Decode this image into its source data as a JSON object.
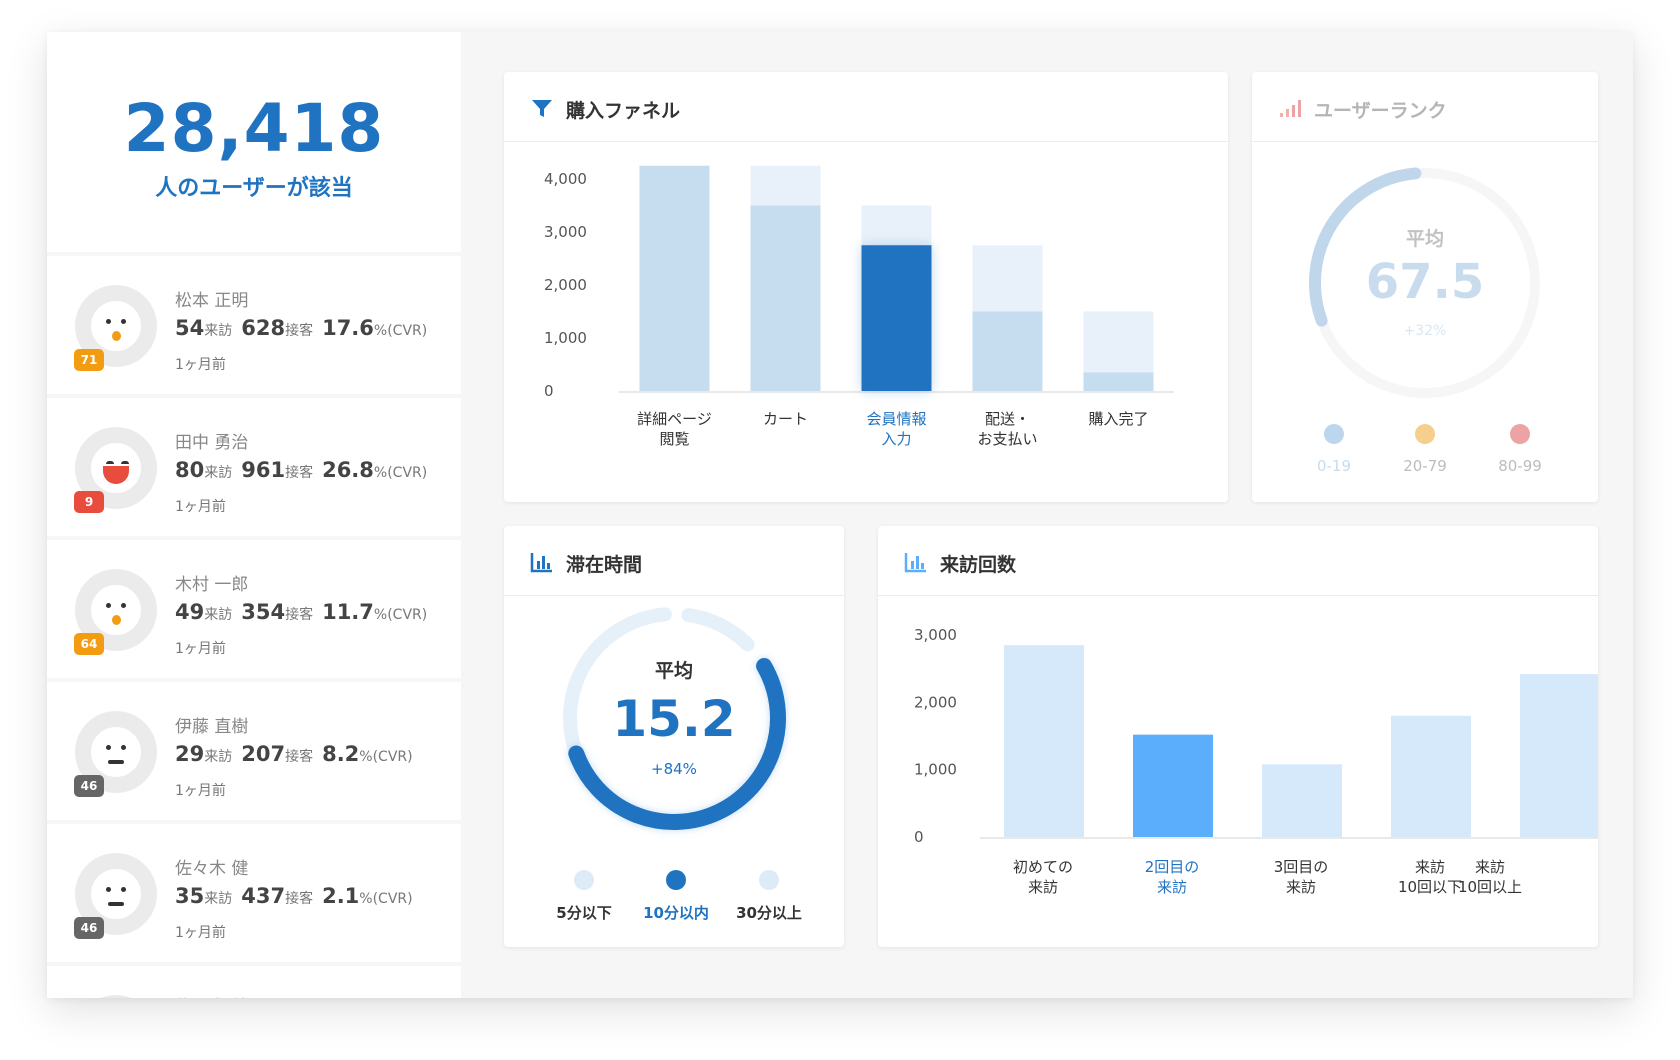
{
  "summary": {
    "count": "28,418",
    "caption": "人のユーザーが該当"
  },
  "users": [
    {
      "name": "松本 正明",
      "visits": "54",
      "visits_unit": "来訪",
      "service": "628",
      "service_unit": "接客",
      "cvr": "17.6",
      "cvr_unit": "%(CVR)",
      "time": "1ヶ月前",
      "rank": "71",
      "rank_color": "#f39c12",
      "face": "o"
    },
    {
      "name": "田中 勇治",
      "visits": "80",
      "visits_unit": "来訪",
      "service": "961",
      "service_unit": "接客",
      "cvr": "26.8",
      "cvr_unit": "%(CVR)",
      "time": "1ヶ月前",
      "rank": "9",
      "rank_color": "#e84c3d",
      "face": "smile"
    },
    {
      "name": "木村 一郎",
      "visits": "49",
      "visits_unit": "来訪",
      "service": "354",
      "service_unit": "接客",
      "cvr": "11.7",
      "cvr_unit": "%(CVR)",
      "time": "1ヶ月前",
      "rank": "64",
      "rank_color": "#f39c12",
      "face": "o"
    },
    {
      "name": "伊藤 直樹",
      "visits": "29",
      "visits_unit": "来訪",
      "service": "207",
      "service_unit": "接客",
      "cvr": "8.2",
      "cvr_unit": "%(CVR)",
      "time": "1ヶ月前",
      "rank": "46",
      "rank_color": "#666666",
      "face": "flat"
    },
    {
      "name": "佐々木 健",
      "visits": "35",
      "visits_unit": "来訪",
      "service": "437",
      "service_unit": "接客",
      "cvr": "2.1",
      "cvr_unit": "%(CVR)",
      "time": "1ヶ月前",
      "rank": "46",
      "rank_color": "#666666",
      "face": "flat"
    }
  ],
  "partial_user": {
    "name": "佐々木 健"
  },
  "funnel": {
    "title": "購入ファネル",
    "icon": "funnel-icon"
  },
  "rank_panel": {
    "title": "ユーザーランク",
    "icon": "signal-bars-icon",
    "avg_label": "平均",
    "avg_value": "67.5",
    "change": "+32%",
    "legend": [
      {
        "label": "0-19",
        "color": "#bcd6ee"
      },
      {
        "label": "20-79",
        "color": "#f7cf8c"
      },
      {
        "label": "80-99",
        "color": "#eda3a3"
      }
    ]
  },
  "stay_panel": {
    "title": "滞在時間",
    "icon": "bar-chart-icon",
    "avg_label": "平均",
    "avg_value": "15.2",
    "change": "+84%",
    "legend": [
      {
        "label": "5分以下",
        "color": "#dcebf7"
      },
      {
        "label": "10分以内",
        "color": "#1f73c1"
      },
      {
        "label": "30分以上",
        "color": "#dcebf7"
      }
    ]
  },
  "visit_panel": {
    "title": "来訪回数",
    "icon": "bar-chart-icon"
  },
  "chart_data": [
    {
      "type": "bar",
      "title": "購入ファネル",
      "categories": [
        "詳細ページ\n閲覧",
        "カート",
        "会員情報\n入力",
        "配送・\nお支払い",
        "購入完了"
      ],
      "series": [
        {
          "values": [
            4250,
            4250,
            3500,
            2750,
            1500
          ]
        },
        {
          "values": [
            4250,
            3500,
            2750,
            1500,
            350
          ]
        }
      ],
      "highlight_index": 2,
      "ylim": [
        0,
        4000
      ],
      "yticks": [
        "4,000",
        "3,000",
        "2,000",
        "1,000",
        "0"
      ],
      "colors": {
        "bar": "#c6dcef",
        "bar_light": "#e8f1f9",
        "highlight": "#1f73c1",
        "highlight_label": "#1f73c1"
      }
    },
    {
      "type": "bar",
      "title": "来訪回数",
      "categories": [
        "初めての\n来訪",
        "2回目の\n来訪",
        "3回目の\n来訪",
        "来訪\n10回以下",
        "来訪\n10回以上"
      ],
      "values": [
        2850,
        1520,
        1080,
        1800,
        2420
      ],
      "highlight_index": 1,
      "ylim": [
        0,
        3000
      ],
      "yticks": [
        "3,000",
        "2,000",
        "1,000",
        "0"
      ],
      "colors": {
        "bar": "#d6e9fb",
        "highlight": "#5aaefc",
        "highlight_label": "#1f73c1"
      }
    }
  ],
  "colors": {
    "brand": "#1f73c1"
  }
}
